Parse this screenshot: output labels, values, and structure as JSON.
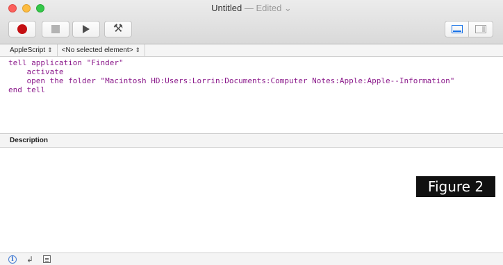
{
  "window": {
    "title": "Untitled",
    "edited_label": " — Edited ⌄"
  },
  "toolbar": {
    "record": "record-button",
    "stop": "stop-button",
    "run": "run-button",
    "compile": "compile-button",
    "accent_color": "#c40f12"
  },
  "navigation": {
    "language": "AppleScript",
    "element": "<No selected element>"
  },
  "editor": {
    "lines": [
      "tell application \"Finder\"",
      "    activate",
      "    open the folder \"Macintosh HD:Users:Lorrin:Documents:Computer Notes:Apple:Apple--Information\"",
      "end tell"
    ],
    "text_color": "#8b1a8b"
  },
  "description": {
    "header": "Description"
  },
  "figure_label": "Figure 2",
  "bottombar": {
    "icons": [
      "info-icon",
      "return-icon",
      "list-icon"
    ]
  }
}
